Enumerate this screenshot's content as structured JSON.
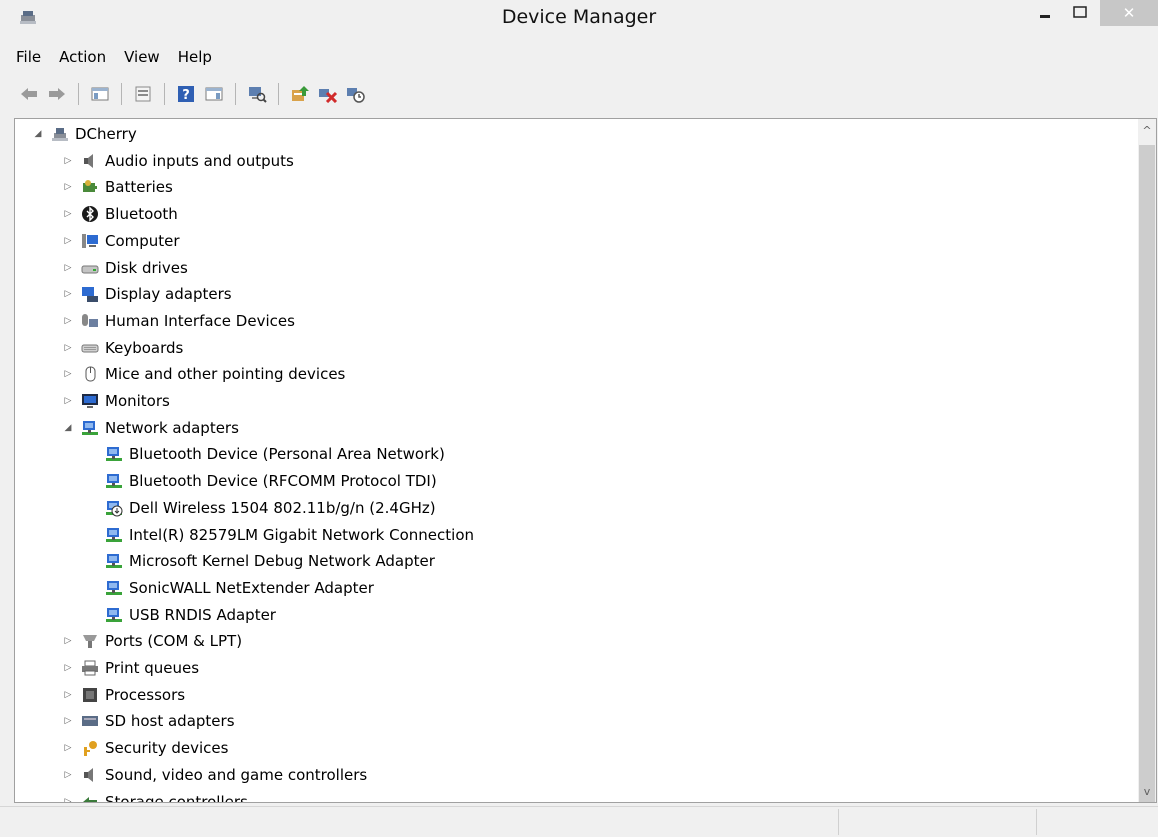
{
  "window": {
    "title": "Device Manager",
    "close_glyph": "✕"
  },
  "menu": [
    {
      "label": "File"
    },
    {
      "label": "Action"
    },
    {
      "label": "View"
    },
    {
      "label": "Help"
    }
  ],
  "toolbar_icons": [
    "back-icon",
    "forward-icon",
    "show-hide-console-tree-icon",
    "properties-icon",
    "help-icon",
    "action-pane-icon",
    "scan-hardware-icon",
    "update-driver-icon",
    "disable-device-icon",
    "uninstall-device-icon"
  ],
  "tree": {
    "root": {
      "label": "DCherry",
      "icon": "computer-root-icon"
    },
    "categories": [
      {
        "label": "Audio inputs and outputs",
        "icon": "speaker-icon"
      },
      {
        "label": "Batteries",
        "icon": "battery-icon"
      },
      {
        "label": "Bluetooth",
        "icon": "bluetooth-icon"
      },
      {
        "label": "Computer",
        "icon": "computer-icon"
      },
      {
        "label": "Disk drives",
        "icon": "disk-drive-icon"
      },
      {
        "label": "Display adapters",
        "icon": "display-adapter-icon"
      },
      {
        "label": "Human Interface Devices",
        "icon": "hid-icon"
      },
      {
        "label": "Keyboards",
        "icon": "keyboard-icon"
      },
      {
        "label": "Mice and other pointing devices",
        "icon": "mouse-icon"
      },
      {
        "label": "Monitors",
        "icon": "monitor-icon"
      },
      {
        "label": "Network adapters",
        "icon": "network-adapter-icon",
        "expanded": true,
        "children": [
          {
            "label": "Bluetooth Device (Personal Area Network)",
            "icon": "network-adapter-icon"
          },
          {
            "label": "Bluetooth Device (RFCOMM Protocol TDI)",
            "icon": "network-adapter-icon"
          },
          {
            "label": "Dell Wireless 1504 802.11b/g/n (2.4GHz)",
            "icon": "network-adapter-disabled-icon"
          },
          {
            "label": "Intel(R) 82579LM Gigabit Network Connection",
            "icon": "network-adapter-icon"
          },
          {
            "label": "Microsoft Kernel Debug Network Adapter",
            "icon": "network-adapter-icon"
          },
          {
            "label": "SonicWALL NetExtender Adapter",
            "icon": "network-adapter-icon"
          },
          {
            "label": "USB RNDIS Adapter",
            "icon": "network-adapter-icon"
          }
        ]
      },
      {
        "label": "Ports (COM & LPT)",
        "icon": "port-icon"
      },
      {
        "label": "Print queues",
        "icon": "printer-icon"
      },
      {
        "label": "Processors",
        "icon": "processor-icon"
      },
      {
        "label": "SD host adapters",
        "icon": "sd-host-icon"
      },
      {
        "label": "Security devices",
        "icon": "security-key-icon"
      },
      {
        "label": "Sound, video and game controllers",
        "icon": "speaker-icon"
      },
      {
        "label": "Storage controllers",
        "icon": "storage-controller-icon"
      }
    ]
  },
  "glyphs": {
    "expanded": "◢",
    "collapsed": "▷",
    "scroll_up": "^",
    "scroll_down": "v"
  }
}
